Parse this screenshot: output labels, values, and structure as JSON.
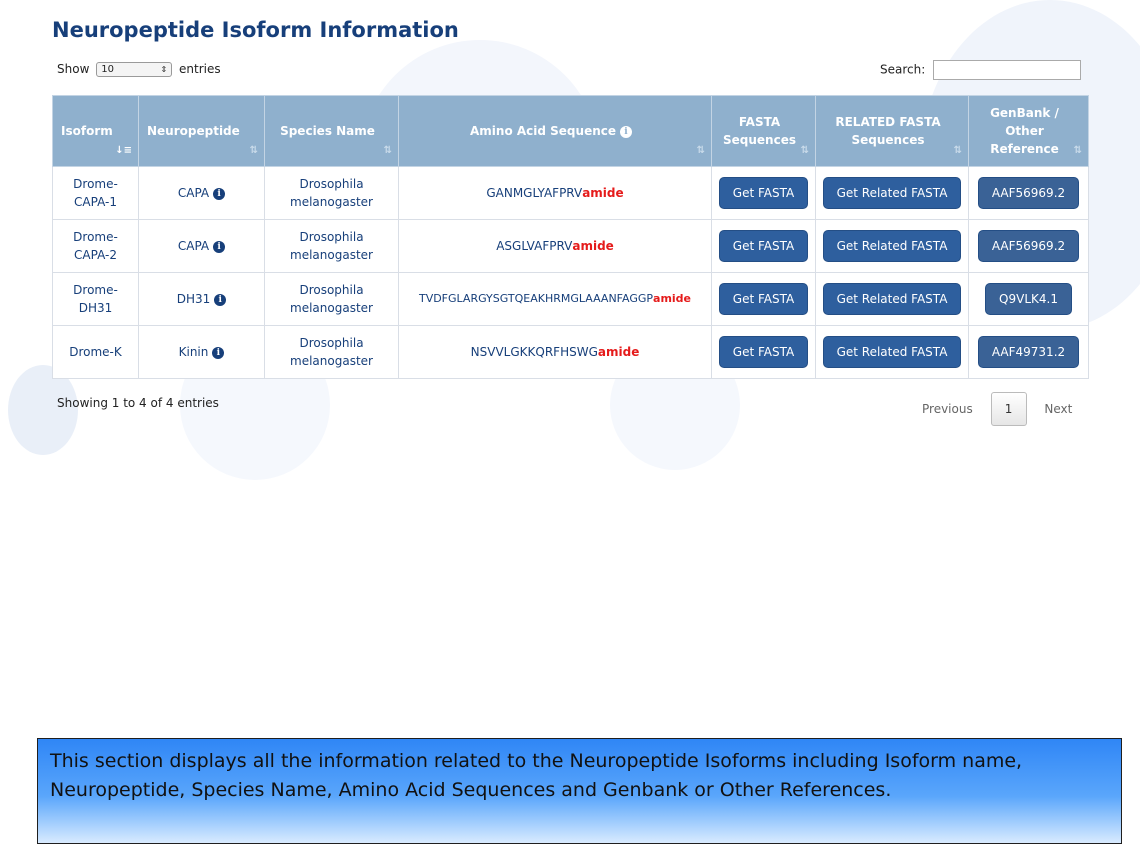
{
  "page": {
    "title": "Neuropeptide Isoform Information",
    "length_prefix": "Show",
    "length_value": "10",
    "length_suffix": "entries",
    "search_label": "Search:",
    "search_value": ""
  },
  "table": {
    "headers": {
      "isoform": "Isoform",
      "neuropeptide": "Neuropeptide",
      "species": "Species Name",
      "sequence": "Amino Acid Sequence",
      "fasta": "FASTA Sequences",
      "related": "RELATED FASTA Sequences",
      "genbank": "GenBank / Other Reference"
    },
    "rows": [
      {
        "isoform": "Drome-CAPA-1",
        "neuropeptide": "CAPA",
        "species": "Drosophila melanogaster",
        "sequence": "GANMGLYAFPRV",
        "suffix": "amide",
        "fasta": "Get FASTA",
        "related": "Get Related FASTA",
        "ref": "AAF56969.2"
      },
      {
        "isoform": "Drome-CAPA-2",
        "neuropeptide": "CAPA",
        "species": "Drosophila melanogaster",
        "sequence": "ASGLVAFPRV",
        "suffix": "amide",
        "fasta": "Get FASTA",
        "related": "Get Related FASTA",
        "ref": "AAF56969.2"
      },
      {
        "isoform": "Drome-DH31",
        "neuropeptide": "DH31",
        "species": "Drosophila melanogaster",
        "sequence": "TVDFGLARGYSGTQEAKHRMGLAAANFAGGP",
        "suffix": "amide",
        "fasta": "Get FASTA",
        "related": "Get Related FASTA",
        "ref": "Q9VLK4.1"
      },
      {
        "isoform": "Drome-K",
        "neuropeptide": "Kinin",
        "species": "Drosophila melanogaster",
        "sequence": "NSVVLGKKQRFHSWG",
        "suffix": "amide",
        "fasta": "Get FASTA",
        "related": "Get Related FASTA",
        "ref": "AAF49731.2"
      }
    ]
  },
  "footer": {
    "info": "Showing 1 to 4 of 4 entries",
    "previous": "Previous",
    "page": "1",
    "next": "Next"
  },
  "note": "This section displays all the information related to the Neuropeptide Isoforms including Isoform name, Neuropeptide, Species Name, Amino Acid Sequences and Genbank or Other References."
}
